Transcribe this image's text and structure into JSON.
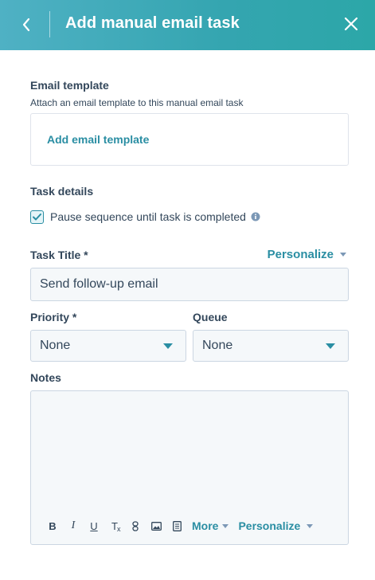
{
  "header": {
    "title": "Add manual email task"
  },
  "email_template": {
    "title": "Email template",
    "description": "Attach an email template to this manual email task",
    "add_link": "Add email template"
  },
  "task_details": {
    "title": "Task details",
    "pause_label": "Pause sequence until task is completed",
    "pause_checked": true
  },
  "task_title": {
    "label": "Task Title *",
    "personalize_label": "Personalize",
    "value": "Send follow-up email"
  },
  "priority": {
    "label": "Priority *",
    "value": "None"
  },
  "queue": {
    "label": "Queue",
    "value": "None"
  },
  "notes": {
    "label": "Notes",
    "value": "",
    "toolbar": {
      "bold": "B",
      "italic": "I",
      "underline": "U",
      "clear_format": "T",
      "more_label": "More",
      "personalize_label": "Personalize"
    }
  },
  "colors": {
    "header_gradient_start": "#4fb1c4",
    "header_gradient_end": "#2ca7a8",
    "accent": "#2a8ea3",
    "text": "#33475b",
    "input_bg": "#f5f8fa",
    "border": "#cbd6e2"
  },
  "icons": {
    "back": "chevron-left-icon",
    "close": "close-icon",
    "info": "info-icon",
    "checkbox": "checkmark-icon"
  }
}
